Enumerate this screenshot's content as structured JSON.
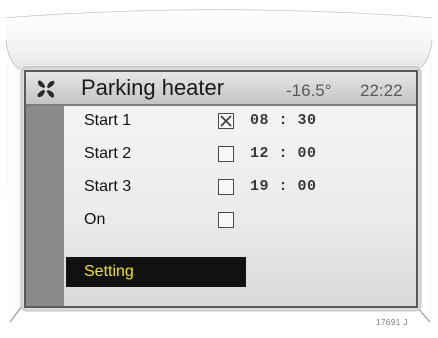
{
  "header": {
    "title": "Parking heater",
    "temperature": "-16.5°",
    "clock": "22:22",
    "icon": "fan-icon"
  },
  "timers": [
    {
      "label": "Start 1",
      "checked": true,
      "time": "08 : 30"
    },
    {
      "label": "Start 2",
      "checked": false,
      "time": "12 : 00"
    },
    {
      "label": "Start 3",
      "checked": false,
      "time": "19 : 00"
    },
    {
      "label": "On",
      "checked": false,
      "time": ""
    }
  ],
  "menu": {
    "setting_label": "Setting"
  },
  "reference": "17691 J",
  "colors": {
    "highlight_bg": "#111111",
    "highlight_text": "#f2e600",
    "left_bar": "#8a8a8a",
    "frame": "#5a5a5a"
  }
}
